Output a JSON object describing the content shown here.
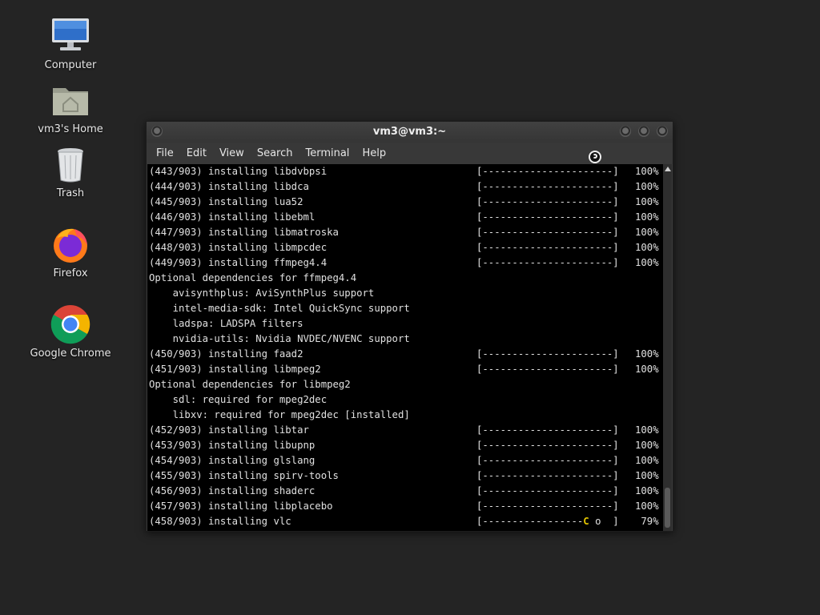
{
  "desktop": {
    "icons": [
      {
        "label": "Computer",
        "icon": "computer-icon"
      },
      {
        "label": "vm3's Home",
        "icon": "home-folder-icon"
      },
      {
        "label": "Trash",
        "icon": "trash-icon"
      },
      {
        "label": "Firefox",
        "icon": "firefox-icon"
      },
      {
        "label": "Google Chrome",
        "icon": "chrome-icon"
      }
    ]
  },
  "window": {
    "title": "vm3@vm3:~",
    "menu": [
      "File",
      "Edit",
      "View",
      "Search",
      "Terminal",
      "Help"
    ]
  },
  "terminal": {
    "lines": [
      {
        "text": "(443/903) installing libdvbpsi",
        "bar": "[----------------------]",
        "pct": "100%"
      },
      {
        "text": "(444/903) installing libdca",
        "bar": "[----------------------]",
        "pct": "100%"
      },
      {
        "text": "(445/903) installing lua52",
        "bar": "[----------------------]",
        "pct": "100%"
      },
      {
        "text": "(446/903) installing libebml",
        "bar": "[----------------------]",
        "pct": "100%"
      },
      {
        "text": "(447/903) installing libmatroska",
        "bar": "[----------------------]",
        "pct": "100%"
      },
      {
        "text": "(448/903) installing libmpcdec",
        "bar": "[----------------------]",
        "pct": "100%"
      },
      {
        "text": "(449/903) installing ffmpeg4.4",
        "bar": "[----------------------]",
        "pct": "100%"
      },
      {
        "text": "Optional dependencies for ffmpeg4.4",
        "bar": "",
        "pct": ""
      },
      {
        "text": "    avisynthplus: AviSynthPlus support",
        "bar": "",
        "pct": ""
      },
      {
        "text": "    intel-media-sdk: Intel QuickSync support",
        "bar": "",
        "pct": ""
      },
      {
        "text": "    ladspa: LADSPA filters",
        "bar": "",
        "pct": ""
      },
      {
        "text": "    nvidia-utils: Nvidia NVDEC/NVENC support",
        "bar": "",
        "pct": ""
      },
      {
        "text": "(450/903) installing faad2",
        "bar": "[----------------------]",
        "pct": "100%"
      },
      {
        "text": "(451/903) installing libmpeg2",
        "bar": "[----------------------]",
        "pct": "100%"
      },
      {
        "text": "Optional dependencies for libmpeg2",
        "bar": "",
        "pct": ""
      },
      {
        "text": "    sdl: required for mpeg2dec",
        "bar": "",
        "pct": ""
      },
      {
        "text": "    libxv: required for mpeg2dec [installed]",
        "bar": "",
        "pct": ""
      },
      {
        "text": "(452/903) installing libtar",
        "bar": "[----------------------]",
        "pct": "100%"
      },
      {
        "text": "(453/903) installing libupnp",
        "bar": "[----------------------]",
        "pct": "100%"
      },
      {
        "text": "(454/903) installing glslang",
        "bar": "[----------------------]",
        "pct": "100%"
      },
      {
        "text": "(455/903) installing spirv-tools",
        "bar": "[----------------------]",
        "pct": "100%"
      },
      {
        "text": "(456/903) installing shaderc",
        "bar": "[----------------------]",
        "pct": "100%"
      },
      {
        "text": "(457/903) installing libplacebo",
        "bar": "[----------------------]",
        "pct": "100%"
      }
    ],
    "current": {
      "text": "(458/903) installing vlc",
      "bar_open": "[-----------------",
      "pacman": "C",
      "bar_rest": " o  ]",
      "pct": " 79%",
      "progress": 0.79
    }
  }
}
